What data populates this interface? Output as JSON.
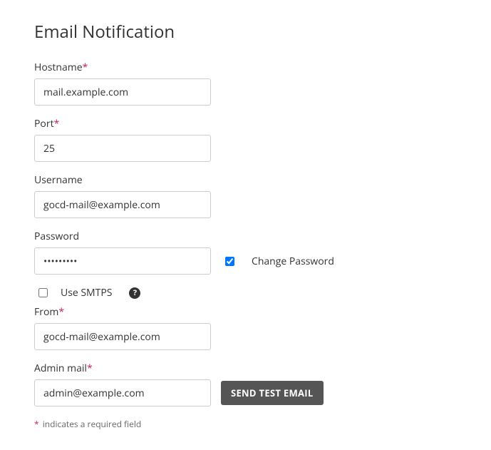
{
  "title": "Email Notification",
  "fields": {
    "hostname": {
      "label": "Hostname",
      "value": "mail.example.com",
      "required": true
    },
    "port": {
      "label": "Port",
      "value": "25",
      "required": true
    },
    "username": {
      "label": "Username",
      "value": "gocd-mail@example.com",
      "required": false
    },
    "password": {
      "label": "Password",
      "value": "•••••••••",
      "required": false
    },
    "change_password": {
      "label": "Change Password",
      "checked": true
    },
    "use_smtps": {
      "label": "Use SMTPS",
      "checked": false
    },
    "from": {
      "label": "From",
      "value": "gocd-mail@example.com",
      "required": true
    },
    "admin_mail": {
      "label": "Admin mail",
      "value": "admin@example.com",
      "required": true
    }
  },
  "buttons": {
    "send_test": "SEND TEST EMAIL"
  },
  "footnote": "indicates a required field",
  "required_mark": "*",
  "help_icon": "?"
}
